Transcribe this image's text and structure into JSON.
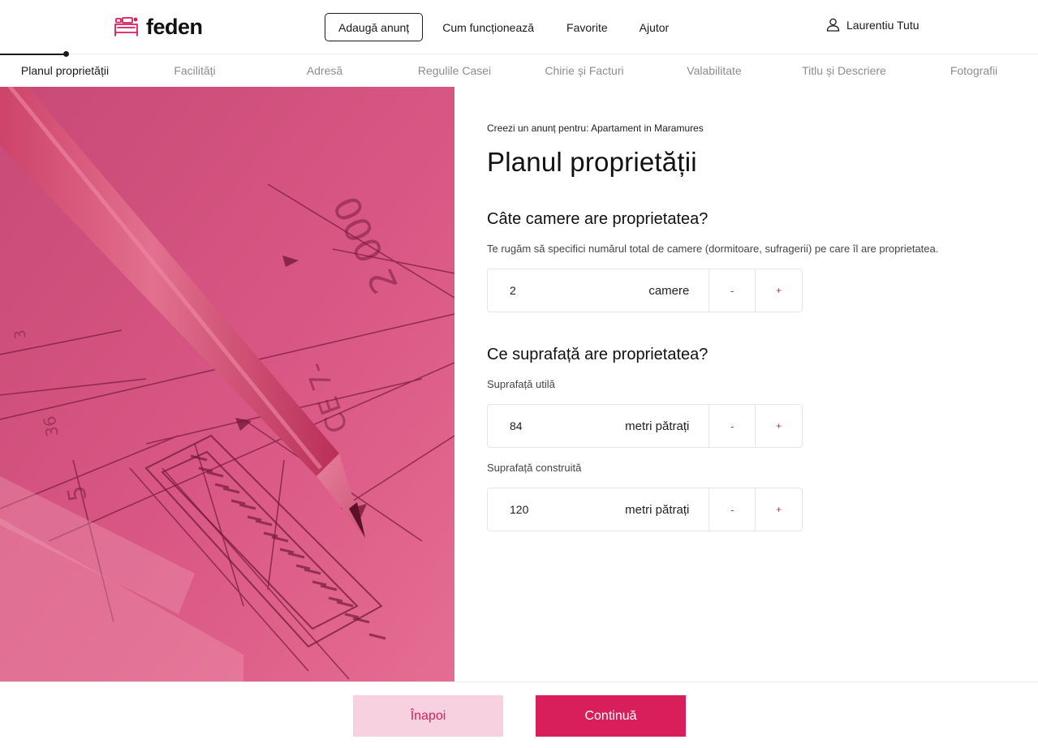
{
  "header": {
    "logo_text": "feden",
    "nav": {
      "add_listing": "Adaugă anunț",
      "how_it_works": "Cum funcționează",
      "favorites": "Favorite",
      "help": "Ajutor"
    },
    "user_name": "Laurentiu Tutu"
  },
  "steps": [
    {
      "label": "Planul proprietății",
      "active": true
    },
    {
      "label": "Facilități",
      "active": false
    },
    {
      "label": "Adresă",
      "active": false
    },
    {
      "label": "Regulile Casei",
      "active": false
    },
    {
      "label": "Chirie și Facturi",
      "active": false
    },
    {
      "label": "Valabilitate",
      "active": false
    },
    {
      "label": "Titlu și Descriere",
      "active": false
    },
    {
      "label": "Fotografii",
      "active": false
    }
  ],
  "form": {
    "context": "Creezi un anunț pentru: Apartament in Maramures",
    "title": "Planul proprietății",
    "rooms": {
      "question": "Câte camere are proprietatea?",
      "description": "Te rugăm să specifici numărul total de camere (dormitoare, sufragerii) pe care îl are proprietatea.",
      "value": "2",
      "unit": "camere",
      "minus": "-",
      "plus": "+"
    },
    "area": {
      "question": "Ce suprafață are proprietatea?",
      "useful": {
        "label": "Suprafață utilă",
        "value": "84",
        "unit": "metri pătrați",
        "minus": "-",
        "plus": "+"
      },
      "built": {
        "label": "Suprafață construită",
        "value": "120",
        "unit": "metri pătrați",
        "minus": "-",
        "plus": "+"
      }
    }
  },
  "footer": {
    "back": "Înapoi",
    "continue": "Continuă"
  },
  "colors": {
    "accent": "#d81e5b",
    "accent_light": "#f7d1df",
    "hero_tint": "#d4537a"
  }
}
